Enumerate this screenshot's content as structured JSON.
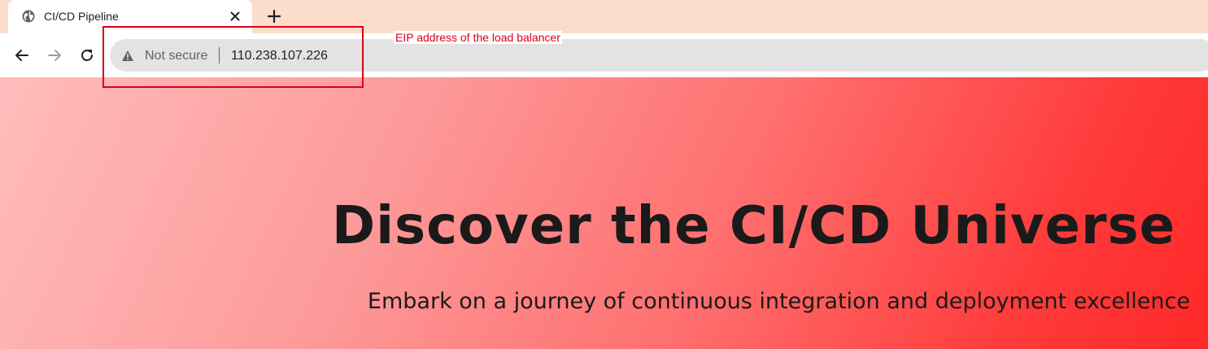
{
  "browser": {
    "tab": {
      "title": "CI/CD Pipeline",
      "favicon": "globe-icon"
    },
    "toolbar": {
      "security_label": "Not secure",
      "url": "110.238.107.226"
    }
  },
  "page": {
    "title": "Discover the CI/CD Universe",
    "subtitle": "Embark on a journey of continuous integration and deployment excellence"
  },
  "annotation": {
    "label": "EIP address of the load balancer",
    "color": "#d9001b"
  },
  "colors": {
    "tabstrip": "#fcdcca",
    "omnibox": "#e3e3e3",
    "gradient_start": "#ffbcbc",
    "gradient_end": "#ff2828"
  }
}
